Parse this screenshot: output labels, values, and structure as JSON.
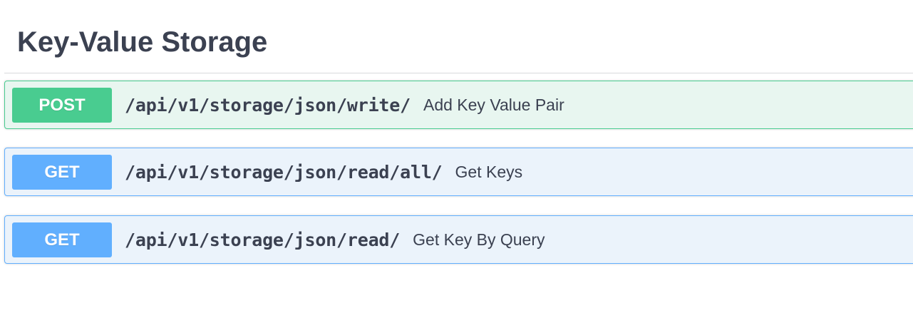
{
  "section": {
    "title": "Key-Value Storage"
  },
  "operations": [
    {
      "method": "POST",
      "path": "/api/v1/storage/json/write/",
      "summary": "Add Key Value Pair",
      "color": "#49cc90"
    },
    {
      "method": "GET",
      "path": "/api/v1/storage/json/read/all/",
      "summary": "Get Keys",
      "color": "#61affe"
    },
    {
      "method": "GET",
      "path": "/api/v1/storage/json/read/",
      "summary": "Get Key By Query",
      "color": "#61affe"
    }
  ]
}
